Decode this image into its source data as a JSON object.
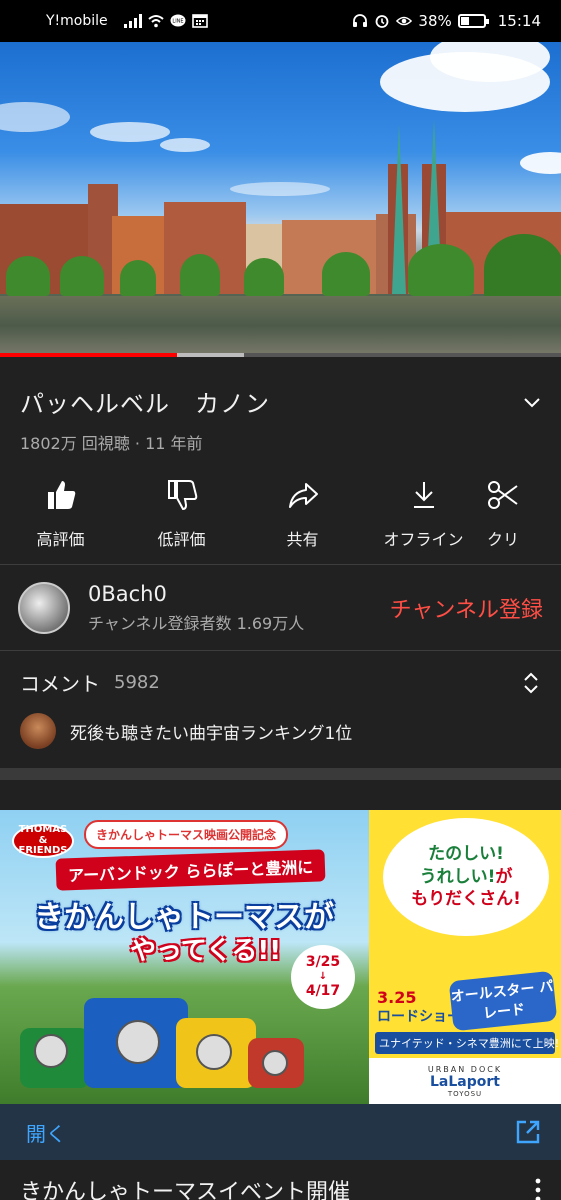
{
  "status_bar": {
    "carrier": "Y!mobile",
    "battery_percent": "38%",
    "battery_level": 0.38,
    "time": "15:14",
    "icons": [
      "signal-icon",
      "wifi-icon",
      "line-icon",
      "calendar-icon",
      "headphones-icon",
      "alarm-icon",
      "eye-comfort-icon",
      "battery-icon"
    ]
  },
  "player": {
    "played_fraction": 0.315,
    "buffered_fraction": 0.435,
    "colors": {
      "played": "#ff0000",
      "buffered": "#bdbdbd"
    }
  },
  "video": {
    "title": "パッヘルベル　カノン",
    "meta": "1802万 回視聴 · 11 年前"
  },
  "actions": [
    {
      "name": "like-button",
      "icon": "thumbs-up-icon",
      "label": "高評価"
    },
    {
      "name": "dislike-button",
      "icon": "thumbs-down-icon",
      "label": "低評価"
    },
    {
      "name": "share-button",
      "icon": "share-icon",
      "label": "共有"
    },
    {
      "name": "download-button",
      "icon": "download-icon",
      "label": "オフライン"
    },
    {
      "name": "clip-button",
      "icon": "scissors-icon",
      "label": "クリ"
    }
  ],
  "channel": {
    "name": "0Bach0",
    "subscribers": "チャンネル登録者数 1.69万人",
    "subscribe_label": "チャンネル登録",
    "subscribe_color": "#ff4e45"
  },
  "comments": {
    "label": "コメント",
    "count": "5982",
    "top_comment": "死後も聴きたい曲宇宙ランキング1位"
  },
  "ad": {
    "badge": "きかんしゃトーマス映画公開記念",
    "logo": "THOMAS & FRIENDS",
    "sub_headline": "アーバンドック ららぽーと豊洲に",
    "headline": "きかんしゃトーマスが",
    "headline2": "やってくる!!",
    "date_start": "3/25",
    "date_end": "4/17",
    "bubble_line1": "たのしい!",
    "bubble_line2": "うれしい!",
    "bubble_line2b": "が",
    "bubble_line3": "もりだくさん!",
    "release_date": "3.25",
    "release_label": "ロードショー",
    "parade": "オールスター パレード",
    "strip": "ユナイテッド・シネマ豊洲にて上映!",
    "mall_top": "URBAN DOCK",
    "mall_name": "LaLaport",
    "mall_sub": "TOYOSU",
    "open_label": "開く",
    "title": "きかんしゃトーマスイベント開催"
  }
}
